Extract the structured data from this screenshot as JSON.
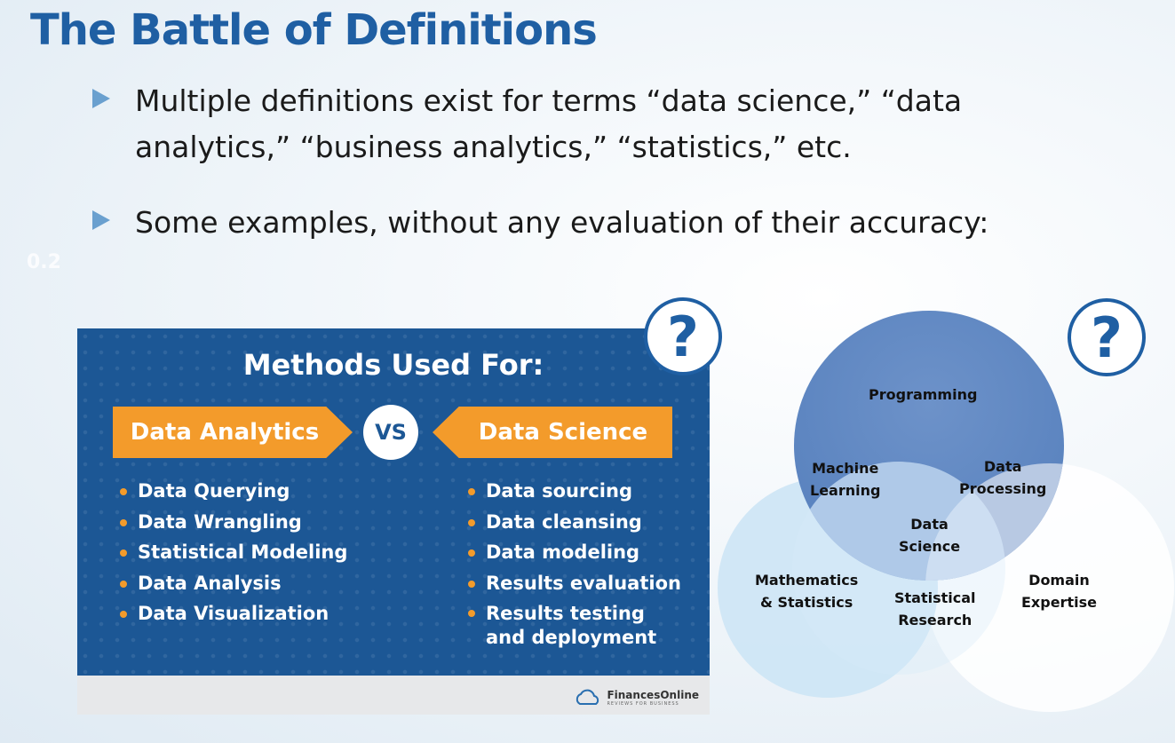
{
  "slide": {
    "title": "The Battle of Definitions",
    "bullets": [
      "Multiple definitions exist for terms “data science,” “data analytics,” “business analytics,” “statistics,” etc.",
      "Some examples, without any evaluation of their accuracy:"
    ],
    "faint_mark": "0.2"
  },
  "infographic": {
    "title": "Methods Used For:",
    "left_banner": "Data Analytics",
    "vs": "VS",
    "right_banner": "Data Science",
    "left_items": [
      "Data Querying",
      "Data Wrangling",
      "Statistical Modeling",
      "Data Analysis",
      "Data Visualization"
    ],
    "right_items": [
      "Data sourcing",
      "Data cleansing",
      "Data modeling",
      "Results evaluation",
      "Results testing",
      "and deployment"
    ],
    "logo_name": "FinancesOnline",
    "logo_tag": "REVIEWS FOR BUSINESS",
    "colors": {
      "background": "#1c5795",
      "accent": "#f39b2b"
    }
  },
  "question_icons": {
    "glyph": "?",
    "icon": "question-mark-icon"
  },
  "venn": {
    "programming": "Programming",
    "machine_learning": [
      "Machine",
      "Learning"
    ],
    "data_processing": [
      "Data",
      "Processing"
    ],
    "data_science": [
      "Data",
      "Science"
    ],
    "math_stats": [
      "Mathematics",
      "& Statistics"
    ],
    "statistical_research": [
      "Statistical",
      "Research"
    ],
    "domain_expertise": [
      "Domain",
      "Expertise"
    ]
  }
}
